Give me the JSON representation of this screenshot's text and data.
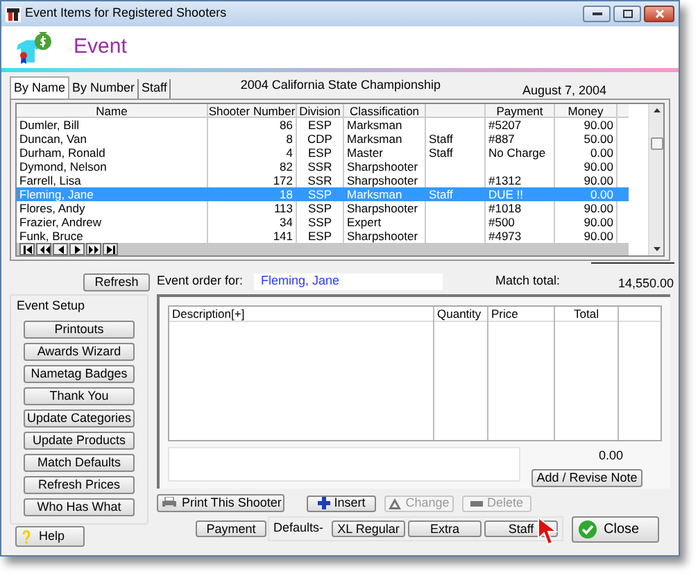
{
  "window": {
    "title": "Event Items for Registered Shooters"
  },
  "header": {
    "title": "Event"
  },
  "tabs": [
    {
      "label": "By Name",
      "selected": true
    },
    {
      "label": "By Number",
      "selected": false
    },
    {
      "label": "Staff",
      "selected": false
    }
  ],
  "event_name": "2004 California State Championship",
  "date": "August  7, 2004",
  "table": {
    "columns": {
      "name": "Name",
      "number": "Shooter Number",
      "division": "Division",
      "classification": "Classification",
      "payment": "Payment",
      "money": "Money"
    },
    "rows": [
      {
        "name": "Dumler, Bill",
        "number": "86",
        "division": "ESP",
        "classification": "Marksman",
        "payment": "#5207",
        "money": "90.00",
        "selected": false
      },
      {
        "name": "Duncan, Van",
        "number": "8",
        "division": "CDP",
        "classification": "Marksman",
        "column_5": "Staff",
        "payment": "#887",
        "money": "50.00",
        "selected": false
      },
      {
        "name": "Durham, Ronald",
        "number": "4",
        "division": "ESP",
        "classification": "Master",
        "column_5": "Staff",
        "payment": "No Charge",
        "money": "0.00",
        "selected": false
      },
      {
        "name": "Dymond, Nelson",
        "number": "82",
        "division": "SSR",
        "classification": "Sharpshooter",
        "money": "90.00",
        "selected": false
      },
      {
        "name": "Farrell, Lisa",
        "number": "172",
        "division": "SSR",
        "classification": "Sharpshooter",
        "payment": "#1312",
        "money": "90.00",
        "selected": false
      },
      {
        "name": "Fleming, Jane",
        "number": "18",
        "division": "SSP",
        "classification": "Marksman",
        "column_5": "Staff",
        "payment": "DUE !!",
        "money": "0.00",
        "selected": true
      },
      {
        "name": "Flores, Andy",
        "number": "113",
        "division": "SSP",
        "classification": "Sharpshooter",
        "payment": "#1018",
        "money": "90.00",
        "selected": false
      },
      {
        "name": "Frazier, Andrew",
        "number": "34",
        "division": "SSP",
        "classification": "Expert",
        "payment": "#500",
        "money": "90.00",
        "selected": false
      },
      {
        "name": "Funk, Bruce",
        "number": "141",
        "division": "ESP",
        "classification": "Sharpshooter",
        "payment": "#4973",
        "money": "90.00",
        "selected": false
      }
    ]
  },
  "refresh_button": "Refresh",
  "order_for": {
    "label": "Event order for:",
    "value": "Fleming, Jane"
  },
  "match_total": {
    "label": "Match total:",
    "value": "14,550.00"
  },
  "event_setup": {
    "title": "Event Setup",
    "buttons": [
      "Printouts",
      "Awards Wizard",
      "Nametag Badges",
      "Thank You",
      "Update Categories",
      "Update Products",
      "Match Defaults",
      "Refresh Prices",
      "Who Has What"
    ]
  },
  "help_button": "Help",
  "items_table": {
    "columns": [
      "Description[+]",
      "Quantity",
      "Price",
      "Total"
    ]
  },
  "items_total": "0.00",
  "note_button": "Add / Revise Note",
  "print_button": "Print This Shooter",
  "actions": [
    {
      "kind": "plus",
      "label": "Insert",
      "disabled": false
    },
    {
      "kind": "triangle",
      "label": "Change",
      "disabled": true
    },
    {
      "kind": "minus",
      "label": "Delete",
      "disabled": true
    }
  ],
  "payment_button": "Payment",
  "defaults": {
    "label": "Defaults-",
    "buttons": [
      "XL Regular",
      "Extra",
      "Staff"
    ]
  },
  "close_button": "Close"
}
